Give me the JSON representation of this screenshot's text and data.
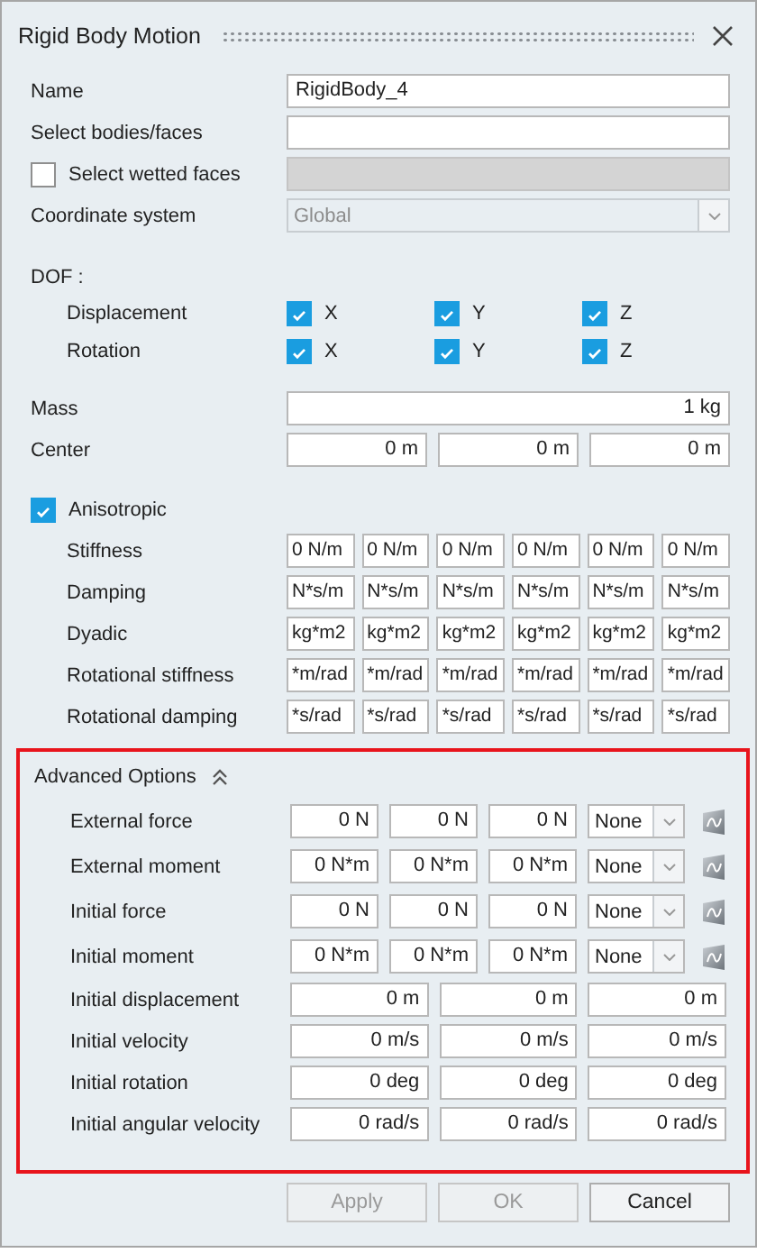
{
  "window": {
    "title": "Rigid Body Motion"
  },
  "fields": [
    {
      "label": "Name",
      "value": "RigidBody_4"
    },
    {
      "label": "Select bodies/faces"
    }
  ],
  "wetted": {
    "label": "Select wetted faces",
    "checked": false,
    "field_disabled": true
  },
  "coordinate_system": {
    "label": "Coordinate system",
    "value": "Global",
    "disabled": true
  },
  "dof": {
    "label": "DOF :",
    "rows": [
      {
        "label": "Displacement",
        "axes": [
          {
            "label": "X",
            "checked": true
          },
          {
            "label": "Y",
            "checked": true
          },
          {
            "label": "Z",
            "checked": true
          }
        ]
      },
      {
        "label": "Rotation",
        "axes": [
          {
            "label": "X",
            "checked": true
          },
          {
            "label": "Y",
            "checked": true
          },
          {
            "label": "Z",
            "checked": true
          }
        ]
      }
    ]
  },
  "mass": {
    "label": "Mass",
    "values": [
      "1 kg"
    ]
  },
  "center": {
    "label": "Center",
    "values": [
      "0 m",
      "0 m",
      "0 m"
    ]
  },
  "anisotropic": {
    "label": "Anisotropic",
    "checked": true,
    "rows": [
      {
        "label": "Stiffness",
        "values": [
          "0 N/m",
          "0 N/m",
          "0 N/m",
          "0 N/m",
          "0 N/m",
          "0 N/m"
        ]
      },
      {
        "label": "Damping",
        "values": [
          "N*s/m",
          "N*s/m",
          "N*s/m",
          "N*s/m",
          "N*s/m",
          "N*s/m"
        ]
      },
      {
        "label": "Dyadic",
        "values": [
          "kg*m2",
          "kg*m2",
          "kg*m2",
          "kg*m2",
          "kg*m2",
          "kg*m2"
        ]
      },
      {
        "label": "Rotational stiffness",
        "values": [
          "*m/rad",
          "*m/rad",
          "*m/rad",
          "*m/rad",
          "*m/rad",
          "*m/rad"
        ]
      },
      {
        "label": "Rotational damping",
        "values": [
          "*s/rad",
          "*s/rad",
          "*s/rad",
          "*s/rad",
          "*s/rad",
          "*s/rad"
        ]
      }
    ]
  },
  "advanced": {
    "label": "Advanced Options",
    "expanded": true,
    "highlighted": true,
    "rows": [
      {
        "kind": "curve",
        "label": "External force",
        "values": [
          "0 N",
          "0 N",
          "0 N"
        ],
        "dropdown": "None"
      },
      {
        "kind": "curve",
        "label": "External moment",
        "values": [
          "0 N*m",
          "0 N*m",
          "0 N*m"
        ],
        "dropdown": "None"
      },
      {
        "kind": "curve",
        "label": "Initial force",
        "values": [
          "0 N",
          "0 N",
          "0 N"
        ],
        "dropdown": "None"
      },
      {
        "kind": "curve",
        "label": "Initial moment",
        "values": [
          "0 N*m",
          "0 N*m",
          "0 N*m"
        ],
        "dropdown": "None"
      },
      {
        "kind": "vector",
        "label": "Initial displacement",
        "values": [
          "0 m",
          "0 m",
          "0 m"
        ]
      },
      {
        "kind": "vector",
        "label": "Initial velocity",
        "values": [
          "0 m/s",
          "0 m/s",
          "0 m/s"
        ]
      },
      {
        "kind": "vector",
        "label": "Initial rotation",
        "values": [
          "0 deg",
          "0 deg",
          "0 deg"
        ]
      },
      {
        "kind": "vector",
        "label": "Initial angular velocity",
        "values": [
          "0 rad/s",
          "0 rad/s",
          "0 rad/s"
        ]
      }
    ]
  },
  "buttons": [
    {
      "label": "Apply",
      "disabled": true
    },
    {
      "label": "OK",
      "disabled": true
    },
    {
      "label": "Cancel",
      "disabled": false
    }
  ]
}
